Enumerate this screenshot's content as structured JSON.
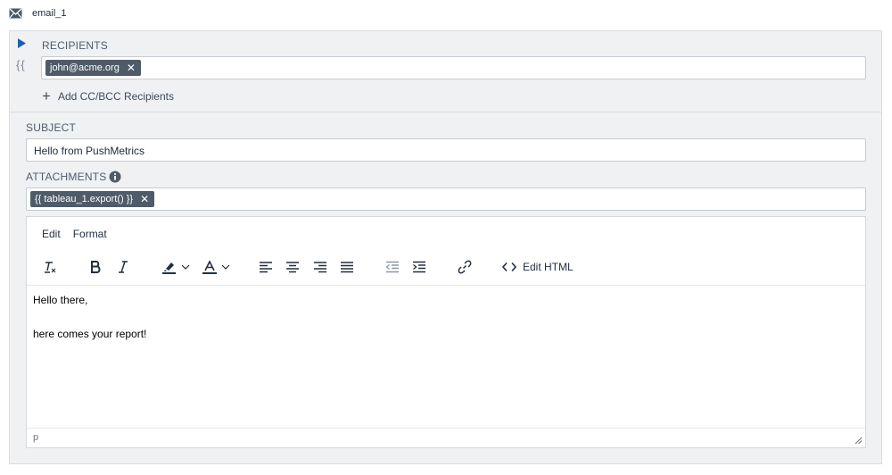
{
  "header": {
    "title": "email_1",
    "icon": "envelope-icon"
  },
  "recipients": {
    "label": "RECIPIENTS",
    "chips": [
      {
        "text": "john@acme.org"
      }
    ],
    "template_icon_glyph": "{{",
    "add_cc_label": "Add CC/BCC Recipients"
  },
  "subject": {
    "label": "SUBJECT",
    "value": "Hello from PushMetrics"
  },
  "attachments": {
    "label": "ATTACHMENTS",
    "chips": [
      {
        "text": "{{ tableau_1.export() }}"
      }
    ]
  },
  "editor": {
    "menu": [
      "Edit",
      "Format"
    ],
    "toolbar": {
      "edit_html_label": "Edit HTML"
    },
    "content_lines": [
      "Hello there,",
      "here comes your report!"
    ],
    "status_path": "p"
  },
  "colors": {
    "panel_bg": "#f0f1f3",
    "chip_bg": "#4f5b68",
    "accent_play": "#1f5fae"
  }
}
